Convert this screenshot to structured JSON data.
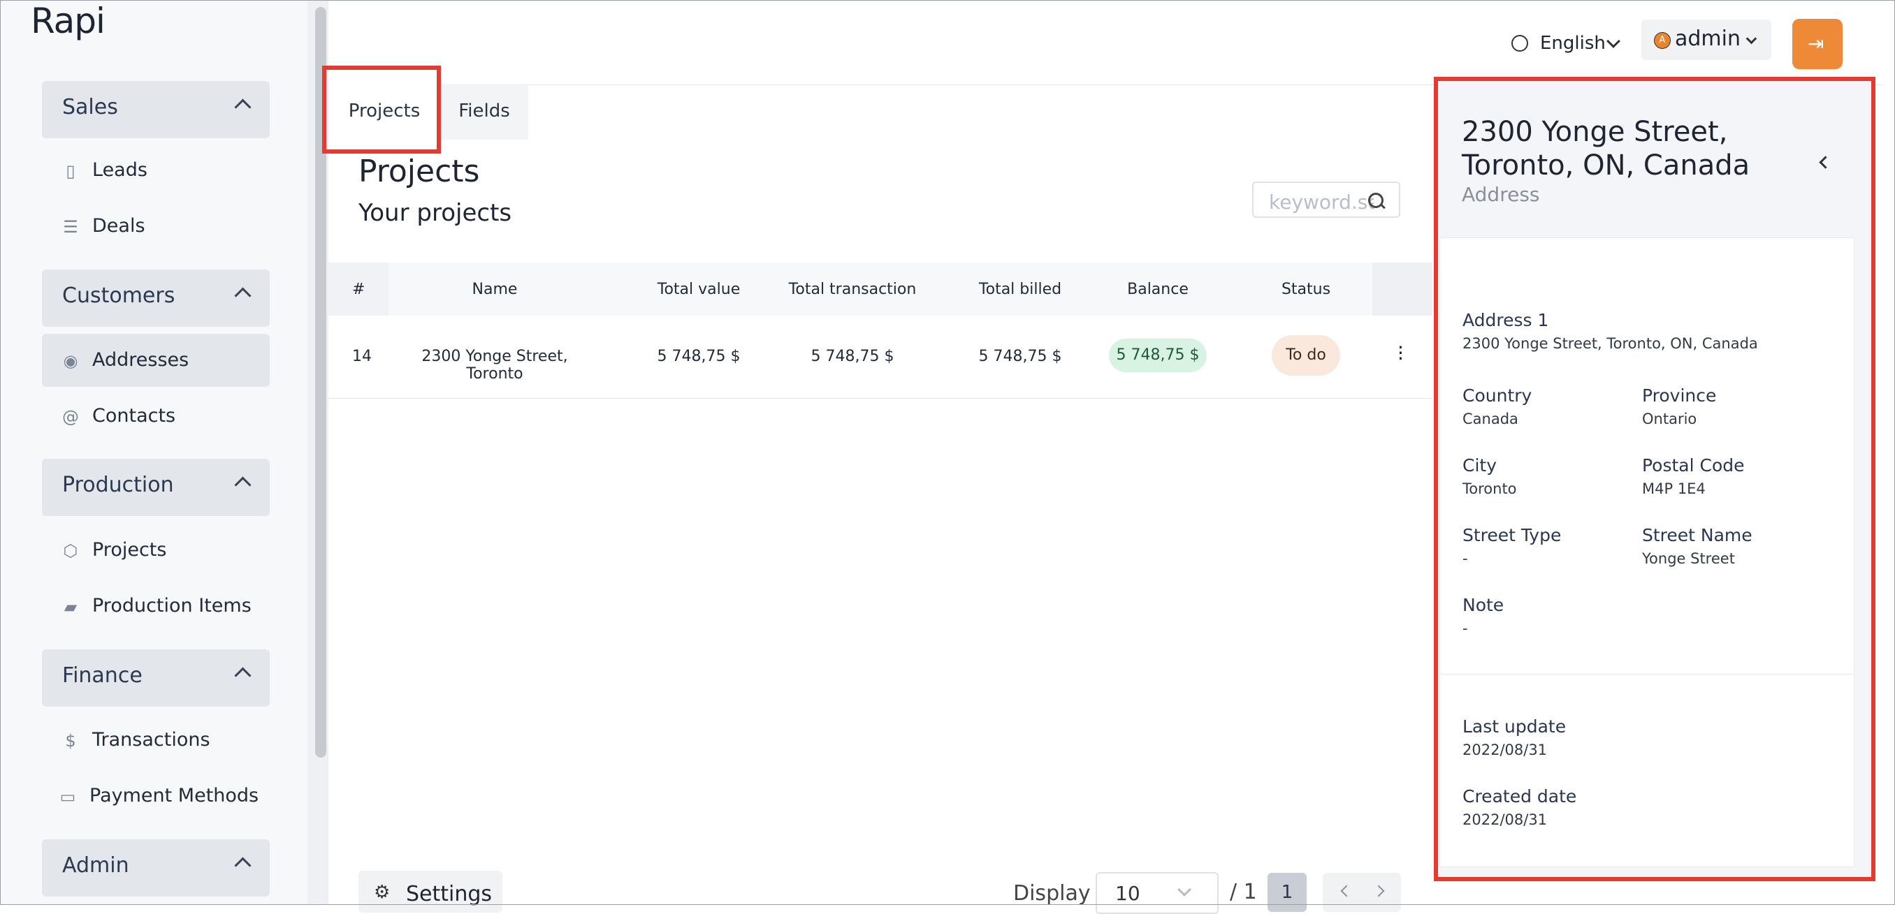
{
  "app": {
    "logo": "Rapi"
  },
  "header": {
    "language": "English",
    "user": "admin",
    "avatar_initial": "A",
    "accent_color": "#ee8a37"
  },
  "sidebar": {
    "groups": [
      {
        "label": "Sales",
        "items": [
          {
            "label": "Leads",
            "icon": "book-icon"
          },
          {
            "label": "Deals",
            "icon": "list-icon"
          }
        ]
      },
      {
        "label": "Customers",
        "items": [
          {
            "label": "Addresses",
            "icon": "map-pin-icon",
            "active": true
          },
          {
            "label": "Contacts",
            "icon": "at-icon"
          }
        ]
      },
      {
        "label": "Production",
        "items": [
          {
            "label": "Projects",
            "icon": "cube-icon"
          },
          {
            "label": "Production Items",
            "icon": "truck-icon"
          }
        ]
      },
      {
        "label": "Finance",
        "items": [
          {
            "label": "Transactions",
            "icon": "dollar-icon"
          },
          {
            "label": "Payment Methods",
            "icon": "credit-card-icon"
          }
        ]
      },
      {
        "label": "Admin",
        "items": []
      }
    ]
  },
  "tabs": [
    {
      "label": "Projects",
      "active": true
    },
    {
      "label": "Fields",
      "active": false
    }
  ],
  "main": {
    "title": "Projects",
    "subtitle": "Your projects",
    "search_placeholder": "keyword.search"
  },
  "table": {
    "columns": [
      "#",
      "Name",
      "Total value",
      "Total transaction",
      "Total billed",
      "Balance",
      "Status"
    ],
    "rows": [
      {
        "id": "14",
        "name": "2300 Yonge Street, Toronto",
        "total_value": "5 748,75 $",
        "total_transaction": "5 748,75 $",
        "total_billed": "5 748,75 $",
        "balance": "5 748,75 $",
        "status": "To do"
      }
    ]
  },
  "footer": {
    "settings": "Settings",
    "display_label": "Display",
    "display_value": "10",
    "pages_total": "/ 1",
    "current_page": "1"
  },
  "detail": {
    "title": "2300 Yonge Street, Toronto, ON, Canada",
    "subtitle": "Address",
    "address1_label": "Address 1",
    "address1_value": "2300 Yonge Street, Toronto, ON, Canada",
    "country_label": "Country",
    "country_value": "Canada",
    "province_label": "Province",
    "province_value": "Ontario",
    "city_label": "City",
    "city_value": "Toronto",
    "postal_label": "Postal Code",
    "postal_value": "M4P 1E4",
    "street_type_label": "Street Type",
    "street_type_value": "-",
    "street_name_label": "Street Name",
    "street_name_value": "Yonge Street",
    "note_label": "Note",
    "note_value": "-",
    "last_update_label": "Last update",
    "last_update_value": "2022/08/31",
    "created_label": "Created date",
    "created_value": "2022/08/31"
  }
}
